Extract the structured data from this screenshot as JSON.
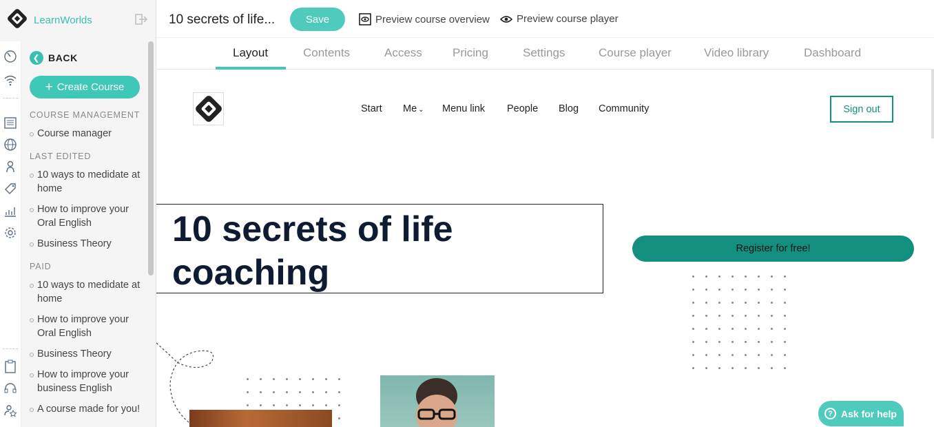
{
  "brand": {
    "name": "LearnWorlds"
  },
  "sidebar": {
    "back_label": "BACK",
    "create_label": "Create Course",
    "sections": {
      "management": {
        "title": "COURSE MANAGEMENT",
        "items": [
          "Course manager"
        ]
      },
      "last_edited": {
        "title": "LAST EDITED",
        "items": [
          "10 ways to medidate at home",
          "How to improve your Oral English",
          "Business Theory"
        ]
      },
      "paid": {
        "title": "PAID",
        "items": [
          "10 ways to medidate at home",
          "How to improve your Oral English",
          "Business Theory",
          "How to improve your business English",
          "A course made for you!"
        ]
      }
    },
    "rail_icons": [
      "speedometer-icon",
      "wifi-icon",
      "list-icon",
      "globe-icon",
      "user-icon",
      "tag-icon",
      "chart-icon",
      "gear-icon",
      "clipboard-icon",
      "headset-icon",
      "star-user-icon"
    ]
  },
  "topbar": {
    "course_title": "10 secrets of life...",
    "save_label": "Save",
    "preview_overview": "Preview course overview",
    "preview_player": "Preview course player"
  },
  "tabs": [
    "Layout",
    "Contents",
    "Access",
    "Pricing",
    "Settings",
    "Course player",
    "Video library",
    "Dashboard"
  ],
  "active_tab": "Layout",
  "site": {
    "nav": [
      "Start",
      "Me",
      "Menu link",
      "People",
      "Blog",
      "Community"
    ],
    "signout_label": "Sign out",
    "hero_title": "10 secrets of life coaching",
    "register_label": "Register for free!"
  },
  "help": {
    "label": "Ask for help"
  },
  "colors": {
    "accent": "#3fc7b8",
    "primary": "#128f7e",
    "hero_text": "#0f1b32"
  }
}
